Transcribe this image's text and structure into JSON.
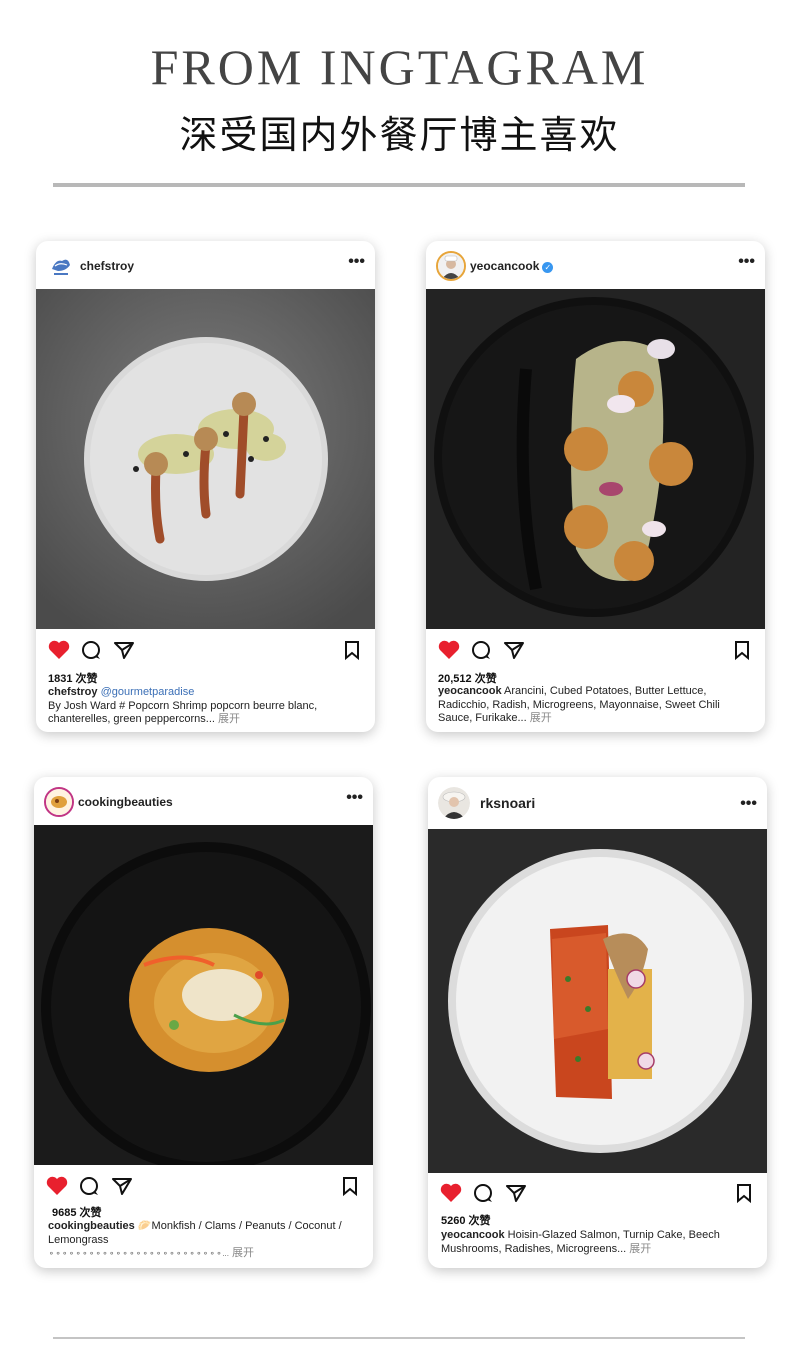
{
  "header": {
    "title": "FROM INGTAGRAM",
    "subtitle": "深受国内外餐厅博主喜欢"
  },
  "posts": [
    {
      "username": "chefstroy",
      "likes": "1831 次赞",
      "caption_user": "chefstroy",
      "mention": "@gourmetparadise",
      "caption_text": "By Josh Ward # Popcorn Shrimp popcorn beurre blanc, chanterelles, green peppercorns...",
      "more": "展开",
      "avatar_icon": "chefstroy-logo-icon"
    },
    {
      "username": "yeocancook",
      "verified": true,
      "likes": "20,512 次赞",
      "caption_user": "yeocancook",
      "caption_text": "Arancini, Cubed Potatoes, Butter Lettuce, Radicchio, Radish, Microgreens, Mayonnaise, Sweet Chili Sauce, Furikake...",
      "more": "展开",
      "avatar_icon": "chef-avatar-icon"
    },
    {
      "username": "cookingbeauties",
      "likes": "9685 次赞",
      "caption_user": "cookingbeauties",
      "caption_text": "🥟Monkfish / Clams / Peanuts / Coconut / Lemongrass",
      "caption_line3": "⚬⚬⚬⚬⚬⚬⚬⚬⚬⚬⚬⚬⚬⚬⚬⚬⚬⚬⚬⚬⚬⚬⚬⚬⚬⚬...",
      "more": "展开",
      "avatar_icon": "food-avatar-icon"
    },
    {
      "username": "rksnoari",
      "likes": "5260 次赞",
      "caption_user": "yeocancook",
      "caption_text": "Hoisin-Glazed Salmon, Turnip Cake, Beech Mushrooms, Radishes, Microgreens...",
      "more": "展开",
      "avatar_icon": "person-avatar-icon"
    }
  ],
  "colors": {
    "heart": "#e8202e",
    "mention": "#3b6fb6",
    "verified": "#3897f0",
    "rule": "#b8b8b8"
  }
}
